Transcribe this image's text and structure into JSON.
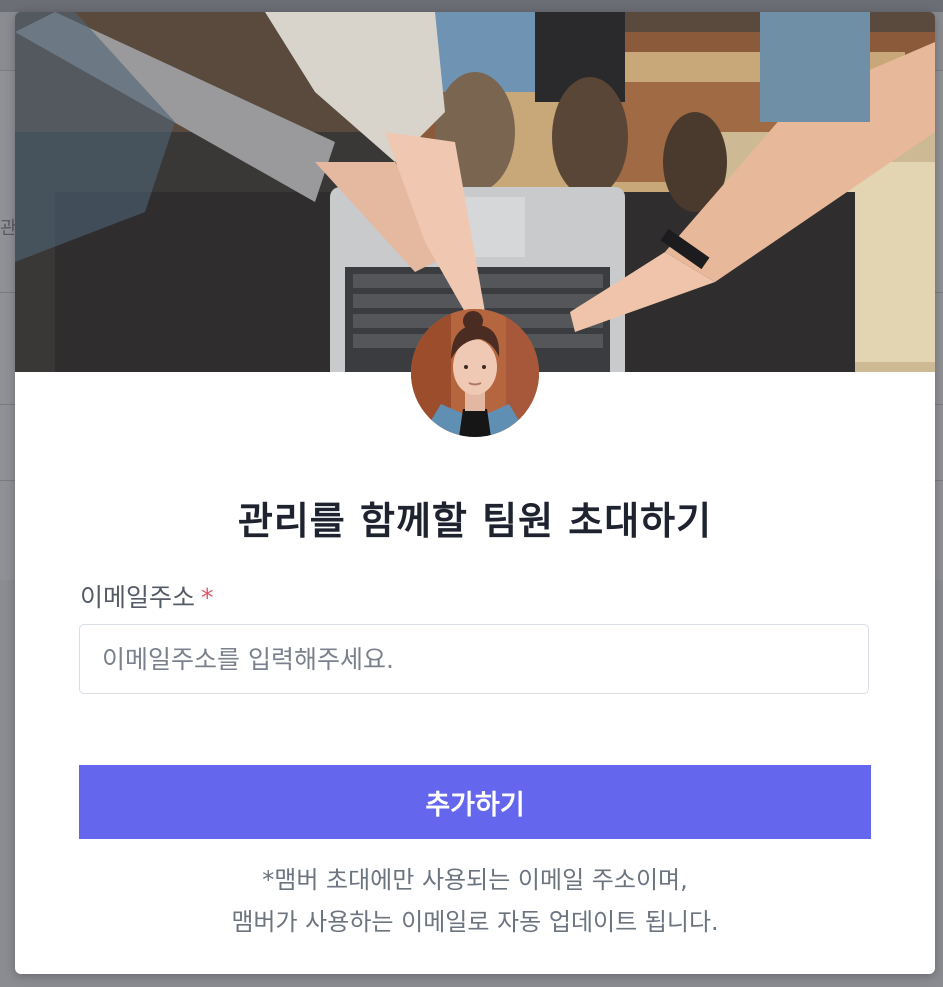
{
  "background": {
    "partial_text": "관리"
  },
  "modal": {
    "title": "관리를 함께할 팀원 초대하기",
    "email_label": "이메일주소",
    "required_mark": "*",
    "email_input": {
      "value": "",
      "placeholder": "이메일주소를 입력해주세요."
    },
    "submit_label": "추가하기",
    "note_line1": "*맴버 초대에만 사용되는 이메일 주소이며,",
    "note_line2": "맴버가 사용하는 이메일로 자동 업데이트 됩니다."
  },
  "colors": {
    "accent": "#6466ee",
    "required": "#e0566c",
    "title": "#1f2330",
    "muted_text": "#6c7480"
  },
  "icons": {
    "hero_image": "team-hands-on-laptop-photo",
    "avatar": "user-avatar-photo"
  }
}
